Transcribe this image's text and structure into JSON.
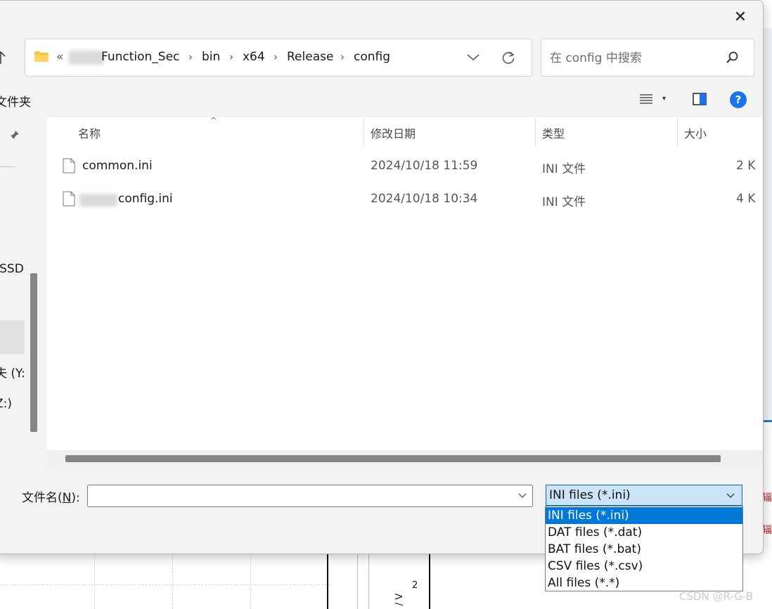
{
  "dialog": {
    "close_glyph": "✕"
  },
  "address_bar": {
    "overflow_marker": "«",
    "crumbs": [
      "Function_Sec",
      "bin",
      "x64",
      "Release",
      "config"
    ],
    "separator": "›",
    "chevron_glyph": "⌵",
    "refresh_glyph": "⟳"
  },
  "search": {
    "placeholder": "在 config 中搜索"
  },
  "command_bar": {
    "new_folder": "文件夹",
    "view_dropdown_glyph": "▾",
    "help_glyph": "?"
  },
  "nav": {
    "items": [
      {
        "label": "-SSD"
      },
      {
        "label": ")"
      },
      {
        "label": "夫 (Y:"
      },
      {
        "label": "Z:)"
      }
    ],
    "pin_glyph": "📌"
  },
  "file_list": {
    "sort_glyph": "^",
    "columns": {
      "name": "名称",
      "modified": "修改日期",
      "type": "类型",
      "size": "大小"
    },
    "rows": [
      {
        "name": "common.ini",
        "modified": "2024/10/18 11:59",
        "type": "INI 文件",
        "size": "2 K"
      },
      {
        "name": "config.ini",
        "modified": "2024/10/18 10:34",
        "type": "INI 文件",
        "size": "4 K"
      }
    ]
  },
  "bottom": {
    "filename_label_pre": "文件名(",
    "filename_label_key": "N",
    "filename_label_post": "):",
    "filename_value": "",
    "combo_chevron": "⌵",
    "filter_selected": "INI files (*.ini)",
    "filter_options": [
      "INI files (*.ini)",
      "DAT files (*.dat)",
      "BAT files (*.bat)",
      "CSV files (*.csv)",
      "All files (*.*)"
    ],
    "filter_selected_index": 0
  },
  "background": {
    "tick_label": "2",
    "axis_label": "/ V",
    "red_glyph": "辐",
    "watermark": "CSDN @R-G-B"
  },
  "colors": {
    "accent": "#0078d7",
    "help_blue": "#1a73e8",
    "filter_highlight": "#cce4f7"
  }
}
